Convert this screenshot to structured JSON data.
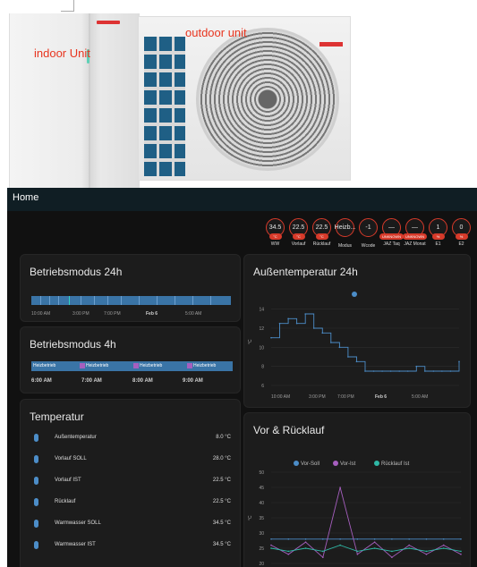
{
  "photo": {
    "indoor_label": "indoor Unit",
    "outdoor_label": "outdoor unit"
  },
  "topbar": {
    "title": "Home"
  },
  "badges": [
    {
      "value": "34.5",
      "unit": "°C",
      "label": "WW"
    },
    {
      "value": "22.5",
      "unit": "°C",
      "label": "Vorlauf"
    },
    {
      "value": "22.5",
      "unit": "°C",
      "label": "Rücklauf"
    },
    {
      "value": "Heizb...",
      "unit": "",
      "label": "Modus"
    },
    {
      "value": "-1",
      "unit": "",
      "label": "Wcode"
    },
    {
      "value": "—",
      "unit": "UNKNOWN",
      "label": "JAZ Taq"
    },
    {
      "value": "—",
      "unit": "UNKNOWN",
      "label": "JAZ Monat"
    },
    {
      "value": "1",
      "unit": "%",
      "label": "E1"
    },
    {
      "value": "0",
      "unit": "%",
      "label": "E2"
    }
  ],
  "betriebsmodus24": {
    "title": "Betriebsmodus 24h",
    "axis": [
      "10:00 AM",
      "3:00 PM",
      "7:00 PM",
      "Feb 6",
      "5:00 AM"
    ]
  },
  "betriebsmodus4": {
    "title": "Betriebsmodus 4h",
    "segments": [
      "Heizbetrieb",
      "Heizbetrieb",
      "Heizbetrieb",
      "Heizbetrieb"
    ],
    "axis": [
      "6:00 AM",
      "7:00 AM",
      "8:00 AM",
      "9:00 AM"
    ]
  },
  "temperatur": {
    "title": "Temperatur",
    "rows": [
      {
        "name": "Außentemperatur",
        "value": "8.0 °C"
      },
      {
        "name": "Vorlauf SOLL",
        "value": "28.0 °C"
      },
      {
        "name": "Vorlauf IST",
        "value": "22.5 °C"
      },
      {
        "name": "Rücklauf",
        "value": "22.5 °C"
      },
      {
        "name": "Warmwasser SOLL",
        "value": "34.5 °C"
      },
      {
        "name": "Warmwasser IST",
        "value": "34.5 °C"
      }
    ]
  },
  "aussen": {
    "title": "Außentemperatur 24h",
    "ylabel": "°C",
    "yticks": [
      "14",
      "12",
      "10",
      "8",
      "6"
    ],
    "xticks": [
      "10:00 AM",
      "3:00 PM",
      "7:00 PM",
      "Feb 6",
      "5:00 AM"
    ],
    "color": "#4c8dc8"
  },
  "ruecklauf": {
    "title": "Vor & Rücklauf",
    "legend": [
      "Vor-Soll",
      "Vor-Ist",
      "Rücklauf Ist"
    ],
    "colors": [
      "#4c8dc8",
      "#a65fbf",
      "#2fb8a6"
    ],
    "ylabel": "°C",
    "yticks": [
      "50",
      "45",
      "40",
      "35",
      "30",
      "25",
      "20"
    ],
    "xticks": [
      "10:00 AM",
      "3:00 PM",
      "7:00 PM",
      "Feb 6",
      "5:00 AM"
    ]
  },
  "chart_data": [
    {
      "type": "line",
      "title": "Außentemperatur 24h",
      "ylabel": "°C",
      "ylim": [
        6,
        15
      ],
      "x": [
        "10:00 AM",
        "3:00 PM",
        "7:00 PM",
        "Feb 6",
        "5:00 AM"
      ],
      "series": [
        {
          "values": [
            11,
            12.5,
            13,
            12.5,
            13.5,
            12,
            11.5,
            10.5,
            10,
            9,
            8.5,
            7.5,
            7.5,
            7.5,
            7.5,
            7.5,
            7.5,
            8,
            7.5,
            7.5,
            7.5,
            7.5,
            8.5
          ]
        }
      ]
    },
    {
      "type": "line",
      "title": "Vor & Rücklauf",
      "ylabel": "°C",
      "ylim": [
        20,
        50
      ],
      "x": [
        "10:00 AM",
        "3:00 PM",
        "7:00 PM",
        "Feb 6",
        "5:00 AM"
      ],
      "series": [
        {
          "name": "Vor-Soll",
          "values": [
            28,
            28,
            28,
            28,
            28,
            28,
            28,
            28,
            28,
            28,
            28,
            28
          ]
        },
        {
          "name": "Vor-Ist",
          "values": [
            26,
            23,
            27,
            22,
            45,
            23,
            27,
            22,
            26,
            23,
            26,
            23
          ]
        },
        {
          "name": "Rücklauf Ist",
          "values": [
            25,
            24,
            25,
            24,
            26,
            24,
            25,
            24,
            25,
            24,
            25,
            24
          ]
        }
      ]
    }
  ]
}
